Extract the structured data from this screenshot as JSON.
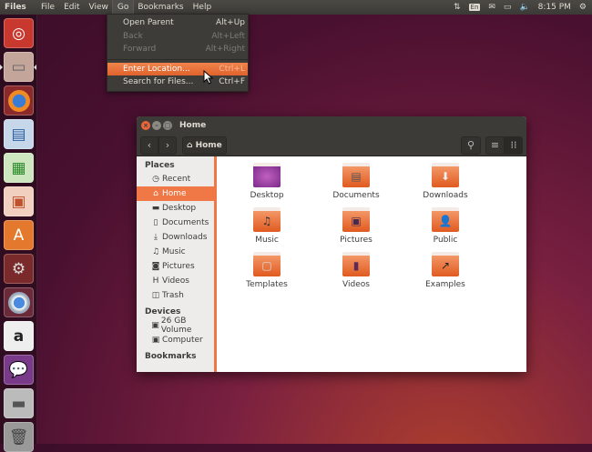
{
  "topbar": {
    "app_name": "Files",
    "menus": [
      "File",
      "Edit",
      "View",
      "Go",
      "Bookmarks",
      "Help"
    ],
    "keyboard": "En",
    "time": "8:15 PM"
  },
  "go_menu": [
    {
      "label": "Open Parent",
      "shortcut": "Alt+Up",
      "enabled": true
    },
    {
      "label": "Back",
      "shortcut": "Alt+Left",
      "enabled": false
    },
    {
      "label": "Forward",
      "shortcut": "Alt+Right",
      "enabled": false
    },
    {
      "label": "Enter Location...",
      "shortcut": "Ctrl+L",
      "enabled": true,
      "highlighted": true
    },
    {
      "label": "Search for Files...",
      "shortcut": "Ctrl+F",
      "enabled": true
    }
  ],
  "window": {
    "title": "Home",
    "path_button": "Home"
  },
  "sidebar": {
    "places_header": "Places",
    "places": [
      {
        "label": "Recent",
        "icon": "clock"
      },
      {
        "label": "Home",
        "icon": "home"
      },
      {
        "label": "Desktop",
        "icon": "folder"
      },
      {
        "label": "Documents",
        "icon": "document"
      },
      {
        "label": "Downloads",
        "icon": "download"
      },
      {
        "label": "Music",
        "icon": "music"
      },
      {
        "label": "Pictures",
        "icon": "camera"
      },
      {
        "label": "Videos",
        "icon": "film"
      },
      {
        "label": "Trash",
        "icon": "trash"
      }
    ],
    "devices_header": "Devices",
    "devices": [
      {
        "label": "26 GB Volume"
      },
      {
        "label": "Computer"
      }
    ],
    "bookmarks_header": "Bookmarks"
  },
  "files": [
    {
      "name": "Desktop"
    },
    {
      "name": "Documents"
    },
    {
      "name": "Downloads"
    },
    {
      "name": "Music"
    },
    {
      "name": "Pictures"
    },
    {
      "name": "Public"
    },
    {
      "name": "Templates"
    },
    {
      "name": "Videos"
    },
    {
      "name": "Examples"
    }
  ],
  "launcher": [
    "Dash",
    "Files",
    "Firefox",
    "LibreOffice Writer",
    "LibreOffice Calc",
    "LibreOffice Impress",
    "Ubuntu Software Center",
    "System Settings",
    "Chromium",
    "Amazon",
    "Empathy",
    "Drive",
    "Trash"
  ]
}
